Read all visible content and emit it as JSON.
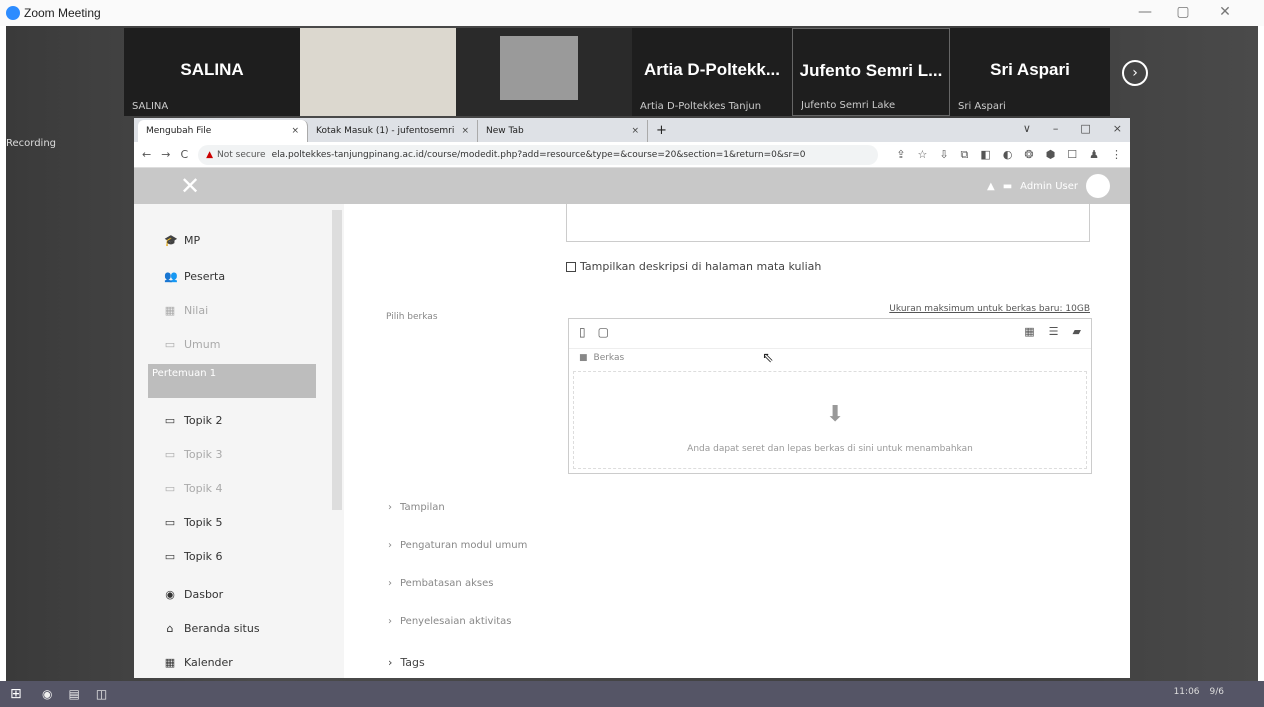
{
  "zoom": {
    "title": "Zoom Meeting",
    "minimize": "—",
    "maximize": "▢",
    "close": "✕",
    "participants": [
      {
        "name": "SALINA",
        "sub": "SALINA"
      },
      {
        "name": "",
        "sub": ""
      },
      {
        "name": "",
        "sub": ""
      },
      {
        "name": "Artia D-Poltekk...",
        "sub": "Artia D-Poltekkes Tanjun"
      },
      {
        "name": "Jufento Semri L...",
        "sub": "Jufento Semri Lake"
      },
      {
        "name": "Sri Aspari",
        "sub": "Sri Aspari"
      }
    ],
    "next": "›",
    "recording_label": "Recording"
  },
  "browser": {
    "tabs": [
      {
        "label": "Mengubah File",
        "close": "×"
      },
      {
        "label": "Kotak Masuk (1) - jufentosemri",
        "close": "×"
      },
      {
        "label": "New Tab",
        "close": "×"
      }
    ],
    "newtab": "+",
    "win_controls": [
      "∨",
      "–",
      "□",
      "×"
    ],
    "nav": [
      "←",
      "→",
      "C"
    ],
    "security": "Not secure",
    "url": "ela.poltekkes-tanjungpinang.ac.id/course/modedit.php?add=resource&type=&course=20&section=1&return=0&sr=0",
    "extensions": [
      "⇪",
      "☆",
      "⇩",
      "⧉",
      "◧",
      "◐",
      "❂",
      "⬢",
      "☐",
      "♟",
      "⋮"
    ]
  },
  "moodle": {
    "close_icon": "✕",
    "user_label": "Admin User",
    "sidebar": [
      {
        "icon": "🎓",
        "label": "MP"
      },
      {
        "icon": "👥",
        "label": "Peserta"
      },
      {
        "icon": "▦",
        "label": "Nilai"
      },
      {
        "icon": "▭",
        "label": "Umum"
      },
      {
        "icon": "▭",
        "label": "Topik 2"
      },
      {
        "icon": "▭",
        "label": "Topik 3"
      },
      {
        "icon": "▭",
        "label": "Topik 4"
      },
      {
        "icon": "▭",
        "label": "Topik 5"
      },
      {
        "icon": "▭",
        "label": "Topik 6"
      },
      {
        "icon": "◉",
        "label": "Dasbor"
      },
      {
        "icon": "⌂",
        "label": "Beranda situs"
      },
      {
        "icon": "▦",
        "label": "Kalender"
      }
    ],
    "sidebar_active": "Pertemuan 1",
    "desc_checkbox_label": "Tampilkan deskripsi di halaman mata kuliah",
    "file_label": "Pilih berkas",
    "max_size": "Ukuran maksimum untuk berkas baru: 10GB",
    "filepicker": {
      "folder": "Berkas",
      "drop_text": "Anda dapat seret dan lepas berkas di sini untuk menambahkan",
      "arrow": "⬇"
    },
    "sections": [
      "Tampilan",
      "Pengaturan modul umum",
      "Pembatasan akses",
      "Penyelesaian aktivitas",
      "Tags"
    ]
  },
  "taskbar": {
    "start": "⊞",
    "icons": [
      "◉",
      "▤",
      "◫"
    ],
    "tray_time": "11:06",
    "tray_date": "9/6"
  }
}
